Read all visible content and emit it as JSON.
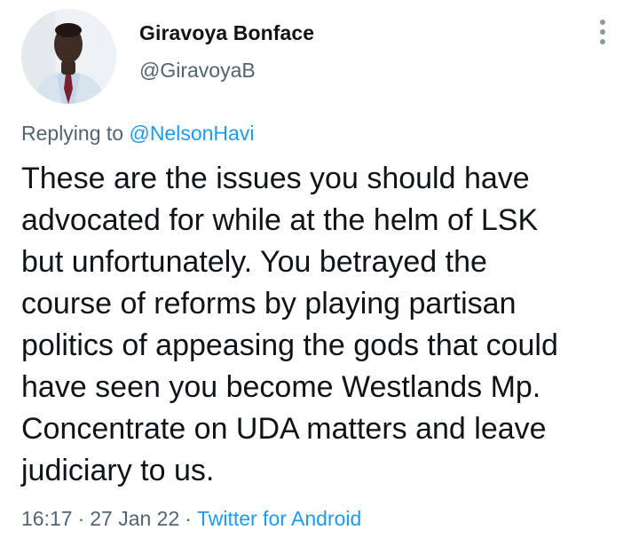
{
  "user": {
    "display_name": "Giravoya Bonface",
    "handle": "@GiravoyaB"
  },
  "menu_icon": "more-vertical-icon",
  "reply": {
    "prefix": "Replying to",
    "mention": "@NelsonHavi"
  },
  "tweet": {
    "lines": [
      "These are the issues you should have",
      "advocated for while at the helm of LSK",
      "but unfortunately. You betrayed the",
      "course of reforms by playing partisan",
      "politics of appeasing the gods that could",
      "have seen you become Westlands Mp.",
      "Concentrate on UDA matters and leave",
      "judiciary to us."
    ]
  },
  "meta": {
    "time": "16:17",
    "date": "27 Jan 22",
    "separator": "·",
    "source": "Twitter for Android"
  },
  "colors": {
    "text_primary": "#0f1419",
    "text_secondary": "#536471",
    "link": "#1d9bf0",
    "icon": "#8b98a5"
  }
}
